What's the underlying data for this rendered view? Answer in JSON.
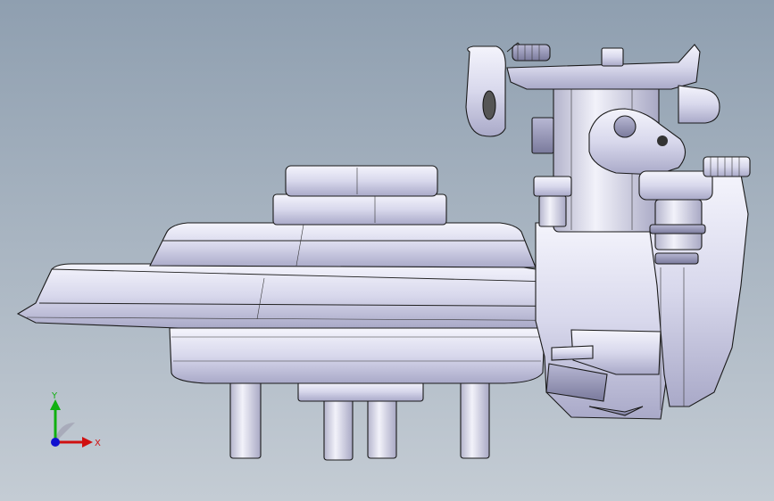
{
  "viewport": {
    "background_top": "#8f9fb0",
    "background_bottom": "#c4ccd4"
  },
  "triad": {
    "x_label": "X",
    "y_label": "Y",
    "x_color": "#d01010",
    "y_color": "#10b010",
    "z_color": "#1010d0"
  }
}
